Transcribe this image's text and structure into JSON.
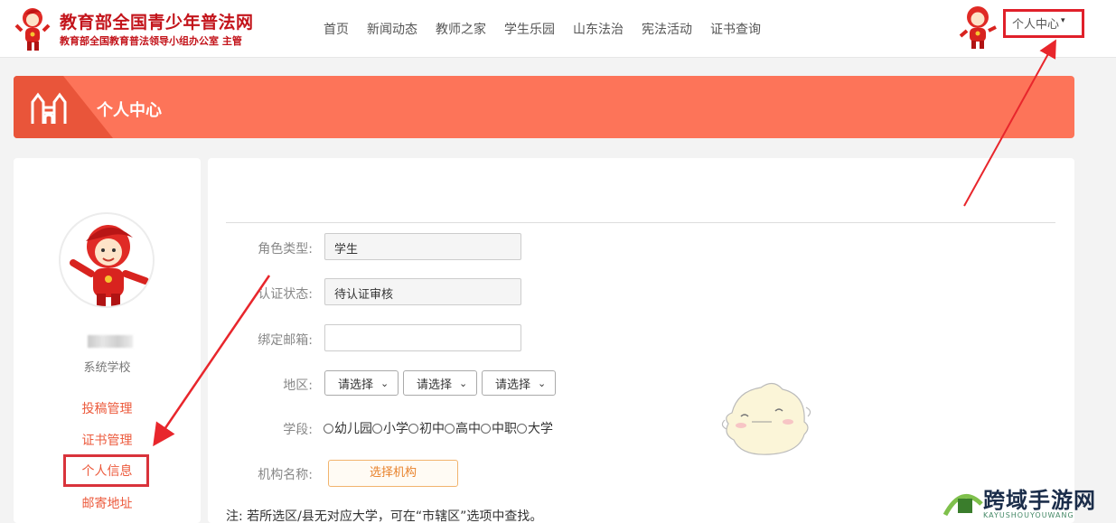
{
  "header": {
    "site_title": "教育部全国青少年普法网",
    "site_subtitle": "教育部全国教育普法领导小组办公室 主管",
    "nav": [
      "首页",
      "新闻动态",
      "教师之家",
      "学生乐园",
      "山东法治",
      "宪法活动",
      "证书查询"
    ],
    "user_menu_label": "个人中心",
    "user_menu_caret": "▾"
  },
  "banner": {
    "title": "个人中心"
  },
  "sidebar": {
    "school": "系统学校",
    "links": [
      "投稿管理",
      "证书管理",
      "个人信息",
      "邮寄地址"
    ],
    "active_link": "个人信息"
  },
  "form": {
    "role_label": "角色类型:",
    "role_value": "学生",
    "status_label": "认证状态:",
    "status_value": "待认证审核",
    "email_label": "绑定邮箱:",
    "email_value": "",
    "region_label": "地区:",
    "region_selects": [
      "请选择",
      "请选择",
      "请选择"
    ],
    "stage_label": "学段:",
    "stages": [
      "幼儿园",
      "小学",
      "初中",
      "高中",
      "中职",
      "大学"
    ],
    "org_label": "机构名称:",
    "org_button": "选择机构",
    "note": "注:  若所选区/县无对应大学，可在“市辖区”选项中查找。"
  },
  "watermark": {
    "text": "跨域手游网",
    "sub": "KAYUSHOUYOUWANG"
  },
  "colors": {
    "brand_red": "#c3141b",
    "banner": "#fd7459",
    "link": "#ec5a3c",
    "highlight_box": "#e0202a"
  }
}
